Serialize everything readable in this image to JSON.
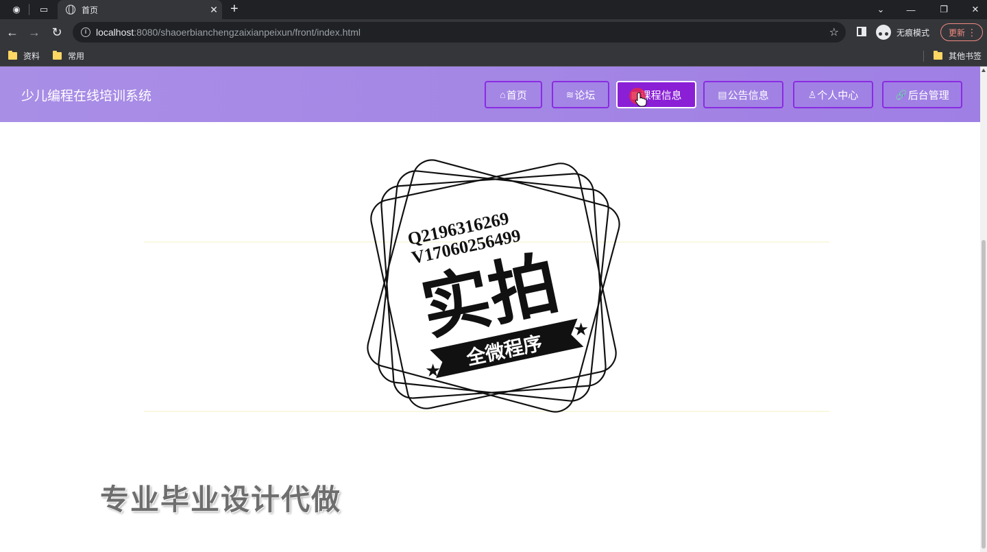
{
  "browser": {
    "tab_title": "首页",
    "url_host": "localhost",
    "url_rest": ":8080/shaoerbianchengzaixianpeixun/front/index.html",
    "incognito_label": "无痕模式",
    "update_label": "更新",
    "bookmarks": [
      "资料",
      "常用"
    ],
    "other_bookmarks": "其他书签"
  },
  "site": {
    "title": "少儿编程在线培训系统",
    "nav": [
      {
        "label": "首页",
        "icon": "home-icon",
        "glyph": "⌂"
      },
      {
        "label": "论坛",
        "icon": "layers-icon",
        "glyph": "≋"
      },
      {
        "label": "课程信息",
        "icon": "grid-icon",
        "glyph": "▦",
        "active": true
      },
      {
        "label": "公告信息",
        "icon": "document-icon",
        "glyph": "▤"
      },
      {
        "label": "个人中心",
        "icon": "user-icon",
        "glyph": "♙"
      },
      {
        "label": "后台管理",
        "icon": "link-icon",
        "glyph": "🔗"
      }
    ]
  },
  "watermark": {
    "line1": "Q2196316269",
    "line2": "V17060256499",
    "big_text": "实拍",
    "banner": "全微程序",
    "bottom_text": "专业毕业设计代做"
  },
  "colors": {
    "header_bg": "#a98ee6",
    "nav_border": "#8a2be2",
    "nav_active_bg": "#8a1fd6"
  }
}
